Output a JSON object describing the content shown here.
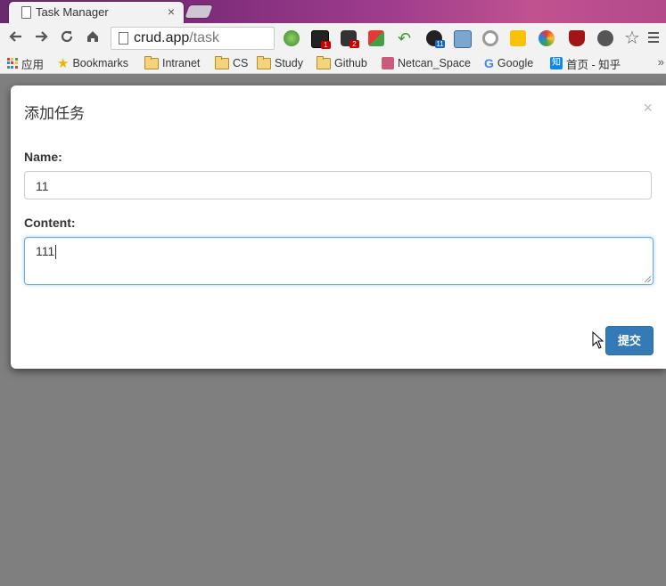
{
  "browser": {
    "tab_title": "Task Manager",
    "tab_close": "×",
    "url_host": "crud.app",
    "url_path": "/task",
    "extension_badges": [
      "1",
      "2",
      "11"
    ],
    "bookmarks": [
      {
        "label": "应用",
        "icon": "apps-grid-icon"
      },
      {
        "label": "Bookmarks",
        "icon": "star-icon"
      },
      {
        "label": "Intranet",
        "icon": "folder-icon"
      },
      {
        "label": "CS",
        "icon": "folder-icon"
      },
      {
        "label": "Study",
        "icon": "folder-icon"
      },
      {
        "label": "Github",
        "icon": "folder-icon"
      },
      {
        "label": "Netcan_Space",
        "icon": "site-icon"
      },
      {
        "label": "Google",
        "icon": "google-icon"
      },
      {
        "label": "首页 - 知乎",
        "icon": "zhihu-icon"
      }
    ],
    "bookmarks_overflow": "»",
    "zhihu_glyph": "知",
    "google_glyph": "G"
  },
  "modal": {
    "title": "添加任务",
    "close": "×",
    "name_label": "Name:",
    "name_value": "11",
    "content_label": "Content:",
    "content_value": "111",
    "submit_label": "提交"
  },
  "colors": {
    "primary": "#337ab7",
    "backdrop": "#7f7f7f",
    "focus_border": "#66afe9"
  }
}
